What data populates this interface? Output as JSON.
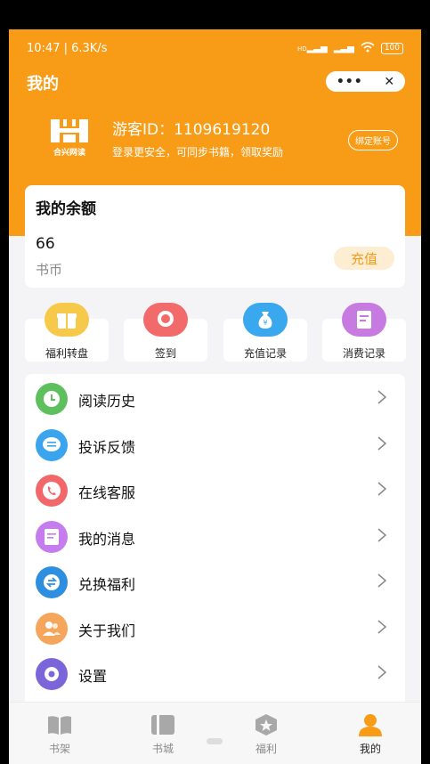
{
  "status_bar": {
    "time_speed": "10:47 | 6.3K/s",
    "signal_label": "HD",
    "battery": "100"
  },
  "header": {
    "title": "我的",
    "more_icon": "more-dots-icon",
    "close_icon": "close-icon"
  },
  "profile": {
    "guest_id": "游客ID：1109619120",
    "hint": "登录更安全，可同步书籍，领取奖励",
    "bind_button": "绑定账号",
    "logo_text": "合兴网读"
  },
  "balance": {
    "title": "我的余额",
    "amount": "66",
    "unit": "书币",
    "recharge_button": "充值"
  },
  "quick_actions": [
    {
      "label": "福利转盘",
      "icon": "gift-box-icon",
      "color": "#f7c94b"
    },
    {
      "label": "签到",
      "icon": "sign-in-badge-icon",
      "color": "#f36a6a"
    },
    {
      "label": "充值记录",
      "icon": "money-bag-icon",
      "color": "#3aa8ee"
    },
    {
      "label": "消费记录",
      "icon": "receipt-icon",
      "color": "#c77be0"
    }
  ],
  "menu": [
    {
      "label": "阅读历史",
      "icon": "clock-icon",
      "color": "#5dc05d"
    },
    {
      "label": "投诉反馈",
      "icon": "chat-bubble-icon",
      "color": "#3aa4ef"
    },
    {
      "label": "在线客服",
      "icon": "phone-icon",
      "color": "#f2686a"
    },
    {
      "label": "我的消息",
      "icon": "message-doc-icon",
      "color": "#c57cee"
    },
    {
      "label": "兑换福利",
      "icon": "exchange-icon",
      "color": "#2e8ee0"
    },
    {
      "label": "关于我们",
      "icon": "people-icon",
      "color": "#f5a65a"
    },
    {
      "label": "设置",
      "icon": "gear-icon",
      "color": "#7b66d9"
    }
  ],
  "tabbar": [
    {
      "label": "书架",
      "icon": "bookshelf-icon"
    },
    {
      "label": "书城",
      "icon": "bookstore-icon"
    },
    {
      "label": "福利",
      "icon": "star-badge-icon"
    },
    {
      "label": "我的",
      "icon": "user-icon",
      "active": true
    }
  ],
  "colors": {
    "brand": "#f89c18",
    "recharge_text": "#f29c19"
  }
}
